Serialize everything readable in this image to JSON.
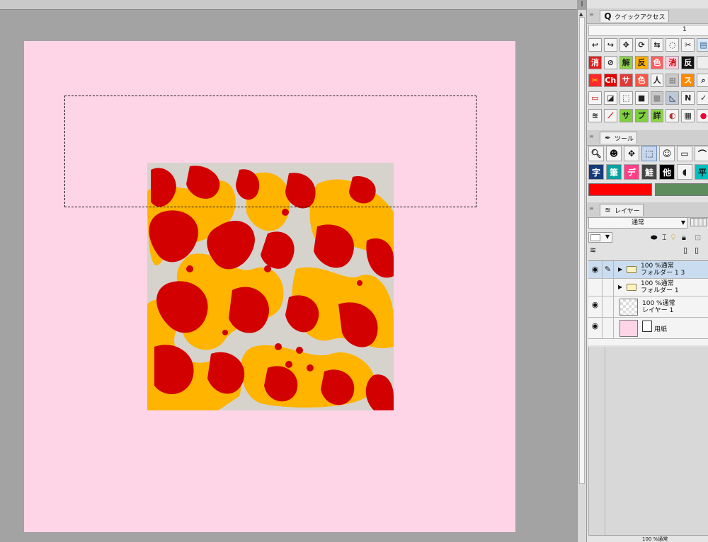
{
  "canvas": {
    "paper_color": "#fdd5e6",
    "artwork_colors": [
      "#d30000",
      "#ffb400",
      "#d6d3cd"
    ]
  },
  "quick_access": {
    "title": "クイックアクセス",
    "page_number": "1",
    "rows": [
      [
        {
          "icon": "undo-icon",
          "glyph": "↩",
          "bg": "#f4f4f4",
          "fg": "#222"
        },
        {
          "icon": "redo-icon",
          "glyph": "↪",
          "bg": "#f4f4f4",
          "fg": "#222"
        },
        {
          "icon": "transform-icon",
          "glyph": "✥",
          "bg": "#f4f4f4",
          "fg": "#222"
        },
        {
          "icon": "rotate-icon",
          "glyph": "⟳",
          "bg": "#f4f4f4",
          "fg": "#222"
        },
        {
          "icon": "flip-icon",
          "glyph": "⇆",
          "bg": "#f4f4f4",
          "fg": "#222"
        },
        {
          "icon": "lasso-icon",
          "glyph": "◌",
          "bg": "#f4f4f4",
          "fg": "#222"
        },
        {
          "icon": "scissors-icon",
          "glyph": "✂",
          "bg": "#f4f4f4",
          "fg": "#222"
        },
        {
          "icon": "paste-icon",
          "glyph": "▤",
          "bg": "#d8e8f8",
          "fg": "#26548a"
        }
      ],
      [
        {
          "icon": "erase-icon",
          "glyph": "消",
          "bg": "#e02020",
          "fg": "#fff"
        },
        {
          "icon": "clear-icon",
          "glyph": "⊘",
          "bg": "#f4f4f4",
          "fg": "#222"
        },
        {
          "icon": "deselect-icon",
          "glyph": "解",
          "bg": "#8fd14a",
          "fg": "#222"
        },
        {
          "icon": "invert-icon",
          "glyph": "反",
          "bg": "#ffb000",
          "fg": "#222"
        },
        {
          "icon": "selection-color-icon",
          "glyph": "色",
          "bg": "#ff6060",
          "fg": "#fff"
        },
        {
          "icon": "erase-selection-icon",
          "glyph": "消",
          "bg": "#ffcee0",
          "fg": "#c00"
        },
        {
          "icon": "reverse-icon",
          "glyph": "反",
          "bg": "#111",
          "fg": "#fff"
        },
        {
          "icon": "blank-icon",
          "glyph": "",
          "bg": "#eee",
          "fg": "#222"
        }
      ],
      [
        {
          "icon": "cut-red-icon",
          "glyph": "✂",
          "bg": "#ff2a2a",
          "fg": "#ffe000"
        },
        {
          "icon": "layer-red-icon",
          "glyph": "Ch",
          "bg": "#e00000",
          "fg": "#fff"
        },
        {
          "icon": "merge-icon",
          "glyph": "サ",
          "bg": "#e23a3a",
          "fg": "#fff"
        },
        {
          "icon": "color-icon",
          "glyph": "色",
          "bg": "#f54",
          "fg": "#fff"
        },
        {
          "icon": "figure-icon",
          "glyph": "人",
          "bg": "#f4f4f4",
          "fg": "#222"
        },
        {
          "icon": "grey-icon",
          "glyph": "▦",
          "bg": "#c9c9c9",
          "fg": "#888"
        },
        {
          "icon": "orange-icon",
          "glyph": "ス",
          "bg": "#ff8a00",
          "fg": "#fff"
        },
        {
          "icon": "search-icon",
          "glyph": "⌕",
          "bg": "#f4f4f4",
          "fg": "#222"
        }
      ],
      [
        {
          "icon": "frame-icon",
          "glyph": "▭",
          "bg": "#f4f4f4",
          "fg": "#c00"
        },
        {
          "icon": "rule-icon",
          "glyph": "◪",
          "bg": "#f4f4f4",
          "fg": "#222"
        },
        {
          "icon": "border-icon",
          "glyph": "⬚",
          "bg": "#f4f4f4",
          "fg": "#222"
        },
        {
          "icon": "square-icon",
          "glyph": "■",
          "bg": "#f4f4f4",
          "fg": "#222"
        },
        {
          "icon": "pattern-icon",
          "glyph": "▩",
          "bg": "#c9c9c9",
          "fg": "#777"
        },
        {
          "icon": "ruler-icon",
          "glyph": "◺",
          "bg": "#bcc9d8",
          "fg": "#222"
        },
        {
          "icon": "n-icon",
          "glyph": "N",
          "bg": "#f4f4f4",
          "fg": "#222"
        },
        {
          "icon": "check-icon",
          "glyph": "✓",
          "bg": "#f4f4f4",
          "fg": "#222"
        }
      ],
      [
        {
          "icon": "layers-icon",
          "glyph": "≋",
          "bg": "#f4f4f4",
          "fg": "#222"
        },
        {
          "icon": "line-icon",
          "glyph": "⟋",
          "bg": "#f4f4f4",
          "fg": "#c00"
        },
        {
          "icon": "sa-icon",
          "glyph": "サ",
          "bg": "#7ed03c",
          "fg": "#222"
        },
        {
          "icon": "pu-icon",
          "glyph": "プ",
          "bg": "#7ed03c",
          "fg": "#222"
        },
        {
          "icon": "detail-icon",
          "glyph": "詳",
          "bg": "#8ad640",
          "fg": "#222"
        },
        {
          "icon": "globe-icon",
          "glyph": "◐",
          "bg": "#f4f4f4",
          "fg": "#a33"
        },
        {
          "icon": "grid-icon",
          "glyph": "▦",
          "bg": "#f4f4f4",
          "fg": "#222"
        },
        {
          "icon": "color-wheel-icon",
          "glyph": "●",
          "bg": "#f4f4f4",
          "fg": "#e03"
        }
      ]
    ]
  },
  "tool_panel": {
    "title": "ツール",
    "row1": [
      {
        "icon": "zoom-icon",
        "glyph": "🔍︎",
        "selected": false
      },
      {
        "icon": "character-icon",
        "glyph": "☻",
        "selected": false
      },
      {
        "icon": "move-icon",
        "glyph": "✥",
        "selected": false
      },
      {
        "icon": "rect-select-icon",
        "glyph": "⬚",
        "selected": true
      },
      {
        "icon": "avatar-icon",
        "glyph": "☺",
        "selected": false
      },
      {
        "icon": "rectangle-icon",
        "glyph": "▭",
        "selected": false
      },
      {
        "icon": "curve-icon",
        "glyph": "⌒",
        "selected": false
      }
    ],
    "row2": [
      {
        "icon": "text-icon",
        "glyph": "字",
        "selected": false,
        "bg": "#153a7a",
        "fg": "#fff"
      },
      {
        "icon": "brush-icon",
        "glyph": "筆",
        "selected": false,
        "bg": "#0aa0a0",
        "fg": "#fff"
      },
      {
        "icon": "deco-icon",
        "glyph": "デ",
        "selected": false,
        "bg": "#ff3f88",
        "fg": "#fff"
      },
      {
        "icon": "fill-icon",
        "glyph": "鮭",
        "selected": false,
        "bg": "#444",
        "fg": "#fff"
      },
      {
        "icon": "other-icon",
        "glyph": "他",
        "selected": false,
        "bg": "#000",
        "fg": "#fff"
      },
      {
        "icon": "blend-icon",
        "glyph": "◖",
        "selected": false,
        "bg": "#f4f4f4",
        "fg": "#222"
      },
      {
        "icon": "flat-icon",
        "glyph": "平",
        "selected": false,
        "bg": "#00c0c0",
        "fg": "#111"
      }
    ],
    "main_color": "#ff0000",
    "sub_color": "#5d8c5d"
  },
  "layer_panel": {
    "title": "レイヤー",
    "blend_mode": "通常",
    "layers": [
      {
        "eye": true,
        "pen": true,
        "type": "folder",
        "line1": "100 %通常",
        "line2": "フォルダー 1 3",
        "selected": true
      },
      {
        "eye": false,
        "pen": false,
        "type": "folder",
        "line1": "100 %通常",
        "line2": "フォルダー 1",
        "selected": false
      },
      {
        "eye": true,
        "pen": false,
        "type": "raster",
        "line1": "100 %通常",
        "line2": "レイヤー 1",
        "selected": false
      },
      {
        "eye": true,
        "pen": false,
        "type": "paper",
        "line1": "",
        "line2": "用紙",
        "selected": false
      }
    ],
    "footer": "100 %通常"
  }
}
